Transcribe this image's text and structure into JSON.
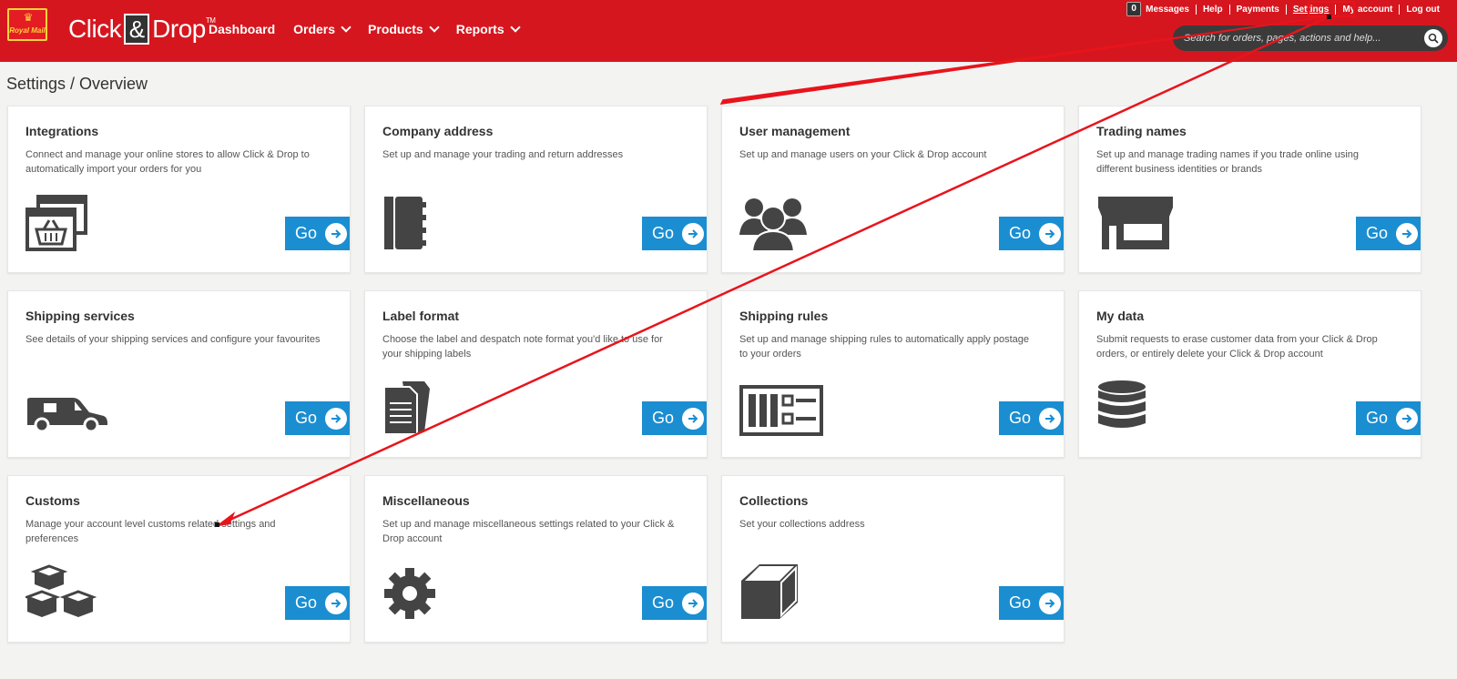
{
  "header": {
    "logo_text": "Royal Mail",
    "brand_left": "Click",
    "brand_amp": "&",
    "brand_right": "Drop",
    "brand_tm": "TM",
    "nav": [
      {
        "label": "Dashboard",
        "dropdown": false
      },
      {
        "label": "Orders",
        "dropdown": true
      },
      {
        "label": "Products",
        "dropdown": true
      },
      {
        "label": "Reports",
        "dropdown": true
      }
    ],
    "messages_count": "0",
    "links": [
      "Messages",
      "Help",
      "Payments",
      "Settings",
      "My account",
      "Log out"
    ],
    "search_placeholder": "Search for orders, pages, actions and help..."
  },
  "breadcrumb": "Settings / Overview",
  "go_label": "Go",
  "cards": [
    {
      "title": "Integrations",
      "desc": "Connect and manage your online stores to allow Click & Drop to automatically import your orders for you",
      "icon": "store-integration-icon"
    },
    {
      "title": "Company address",
      "desc": "Set up and manage your trading and return addresses",
      "icon": "address-book-icon"
    },
    {
      "title": "User management",
      "desc": "Set up and manage users on your Click & Drop account",
      "icon": "users-icon"
    },
    {
      "title": "Trading names",
      "desc": "Set up and manage trading names if you trade online using different business identities or brands",
      "icon": "shopfront-icon"
    },
    {
      "title": "Shipping services",
      "desc": "See details of your shipping services and configure your favourites",
      "icon": "van-icon"
    },
    {
      "title": "Label format",
      "desc": "Choose the label and despatch note format you'd like to use for your shipping labels",
      "icon": "documents-icon"
    },
    {
      "title": "Shipping rules",
      "desc": "Set up and manage shipping rules to automatically apply postage to your orders",
      "icon": "rules-panel-icon"
    },
    {
      "title": "My data",
      "desc": "Submit requests to erase customer data from your Click & Drop orders, or entirely delete your Click & Drop account",
      "icon": "database-icon"
    },
    {
      "title": "Customs",
      "desc": "Manage your account level customs related settings and preferences",
      "icon": "boxes-icon"
    },
    {
      "title": "Miscellaneous",
      "desc": "Set up and manage miscellaneous settings related to your Click & Drop account",
      "icon": "gear-icon"
    },
    {
      "title": "Collections",
      "desc": "Set your collections address",
      "icon": "box-icon"
    }
  ],
  "colors": {
    "brand_red": "#d6161e",
    "go_blue": "#1a8ed1",
    "annotation_red": "#e8141c"
  }
}
